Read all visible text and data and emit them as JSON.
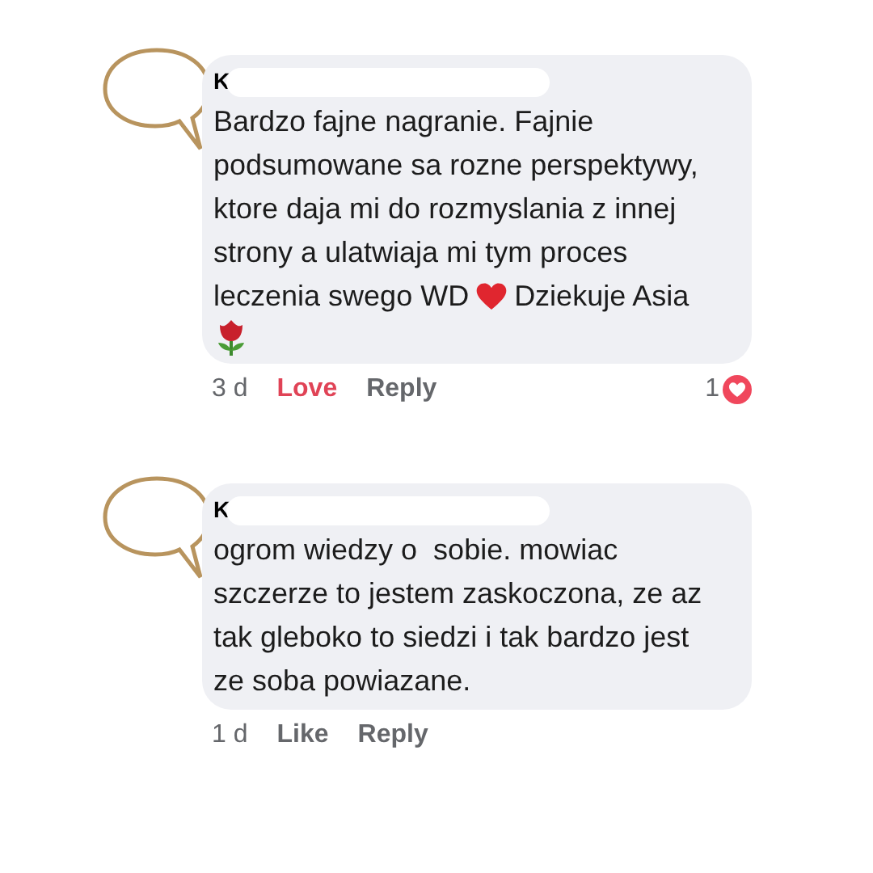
{
  "comments": [
    {
      "author": "K",
      "lines": [
        [
          {
            "kind": "text",
            "text": "Bardzo fajne nagranie. Fajnie"
          }
        ],
        [
          {
            "kind": "text",
            "text": "podsumowane sa rozne perspektywy,"
          }
        ],
        [
          {
            "kind": "text",
            "text": "ktore daja mi do rozmyslania z innej"
          }
        ],
        [
          {
            "kind": "text",
            "text": "strony a ulatwiaja mi tym proces"
          }
        ],
        [
          {
            "kind": "text",
            "text": "leczenia swego WD"
          },
          {
            "kind": "heart"
          },
          {
            "kind": "text",
            "text": "Dziekuje Asia"
          }
        ],
        [
          {
            "kind": "rose"
          }
        ]
      ],
      "time": "3 d",
      "reaction": {
        "label": "Love",
        "selected": true
      },
      "reply": "Reply",
      "reaction_count": "1"
    },
    {
      "author": "K",
      "lines": [
        [
          {
            "kind": "text",
            "text": "ogrom wiedzy o  sobie. mowiac"
          }
        ],
        [
          {
            "kind": "text",
            "text": "szczerze to jestem zaskoczona, ze az"
          }
        ],
        [
          {
            "kind": "text",
            "text": "tak gleboko to siedzi i tak bardzo jest"
          }
        ],
        [
          {
            "kind": "text",
            "text": "ze soba powiazane."
          }
        ]
      ],
      "time": "1 d",
      "reaction": {
        "label": "Like",
        "selected": false
      },
      "reply": "Reply"
    }
  ]
}
